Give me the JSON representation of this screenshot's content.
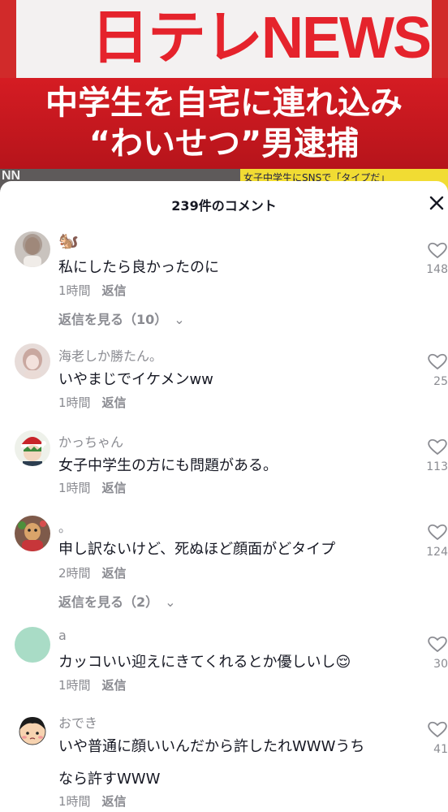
{
  "video": {
    "logo": "日テレNEWS",
    "headline_line1": "中学生を自宅に連れ込み",
    "headline_line2": "“わいせつ”男逮捕",
    "ticker_left": "NN",
    "ticker_right": "女子中学生にSNSで「タイプだ」"
  },
  "sheet": {
    "title": "239件のコメント"
  },
  "comments": [
    {
      "username": "🐿️",
      "text": "私にしたら良かったのに",
      "time": "1時間",
      "reply": "返信",
      "likes": "148",
      "view_replies": "返信を見る（10）"
    },
    {
      "username": "海老しか勝たん。",
      "text": "いやまじでイケメンww",
      "time": "1時間",
      "reply": "返信",
      "likes": "25"
    },
    {
      "username": "かっちゃん",
      "text": "女子中学生の方にも問題がある。",
      "time": "1時間",
      "reply": "返信",
      "likes": "113"
    },
    {
      "username": "。",
      "text": "申し訳ないけど、死ぬほど顔面がどタイプ",
      "time": "2時間",
      "reply": "返信",
      "likes": "124",
      "view_replies": "返信を見る（2）"
    },
    {
      "username": "a",
      "text": "カッコいい迎えにきてくれるとか優しいし😌",
      "time": "1時間",
      "reply": "返信",
      "likes": "30"
    },
    {
      "username": "おでき",
      "text": "いや普通に顔いいんだから許したれWWWうち",
      "text2": "なら許すWWW",
      "time": "1時間",
      "reply": "返信",
      "likes": "41"
    }
  ],
  "colors": {
    "brand_red": "#e5232c",
    "banner_red": "#d51c23",
    "secondary_text": "#8a8b91",
    "primary_text": "#161823"
  }
}
